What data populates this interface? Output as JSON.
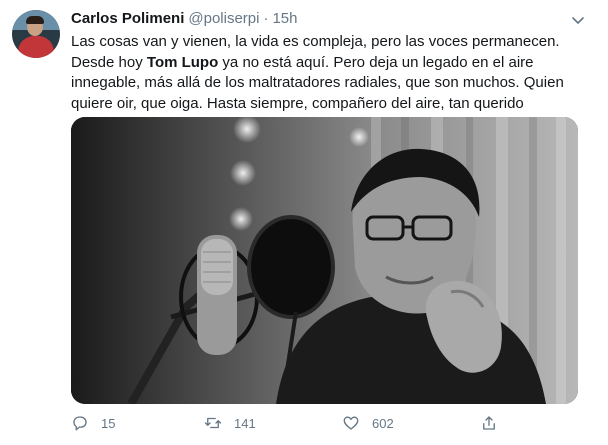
{
  "tweet": {
    "author_name": "Carlos Polimeni",
    "handle": "@poliserpi",
    "separator": "·",
    "time": "15h",
    "text_lines": {
      "l1": "Las cosas van y vienen, la vida es compleja, pero las voces permanecen.",
      "l2_before": "Desde hoy ",
      "l2_bold": "Tom Lupo",
      "l2_after": " ya no está aquí. Pero deja un legado en el aire",
      "l3": "innegable, más allá de los maltratadores radiales, que son muchos. Quien",
      "l4": "quiere oir, que oiga. Hasta siempre, compañero del aire, tan querido"
    },
    "media": {
      "description_icon": "photo",
      "style": "black-and-white"
    },
    "actions": {
      "reply_count": "15",
      "retweet_count": "141",
      "like_count": "602"
    }
  },
  "colors": {
    "text": "#14171a",
    "secondary": "#657786",
    "background": "#ffffff"
  }
}
